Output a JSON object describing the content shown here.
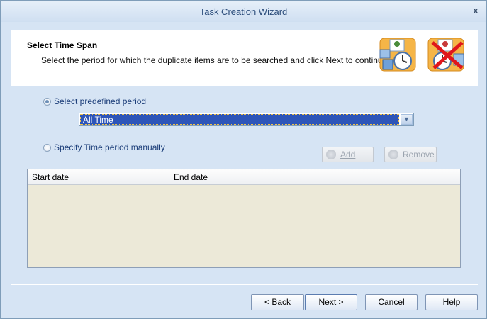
{
  "window": {
    "title": "Task Creation Wizard",
    "close_glyph": "x"
  },
  "header": {
    "title": "Select Time Span",
    "subtitle": "Select the period for which the duplicate items are to be searched and click Next to continue."
  },
  "options": {
    "predefined_label": "Select predefined period",
    "predefined_selected": true,
    "manual_label": "Specify Time period manually",
    "manual_selected": false
  },
  "period_combo": {
    "value": "All Time"
  },
  "buttons": {
    "add": "Add",
    "remove": "Remove",
    "back": "< Back",
    "next": "Next >",
    "cancel": "Cancel",
    "help": "Help"
  },
  "grid": {
    "columns": [
      "Start date",
      "End date"
    ],
    "rows": []
  },
  "colors": {
    "selection": "#2e55b8",
    "window_bg": "#d6e4f4",
    "grid_bg": "#ece9d8"
  }
}
